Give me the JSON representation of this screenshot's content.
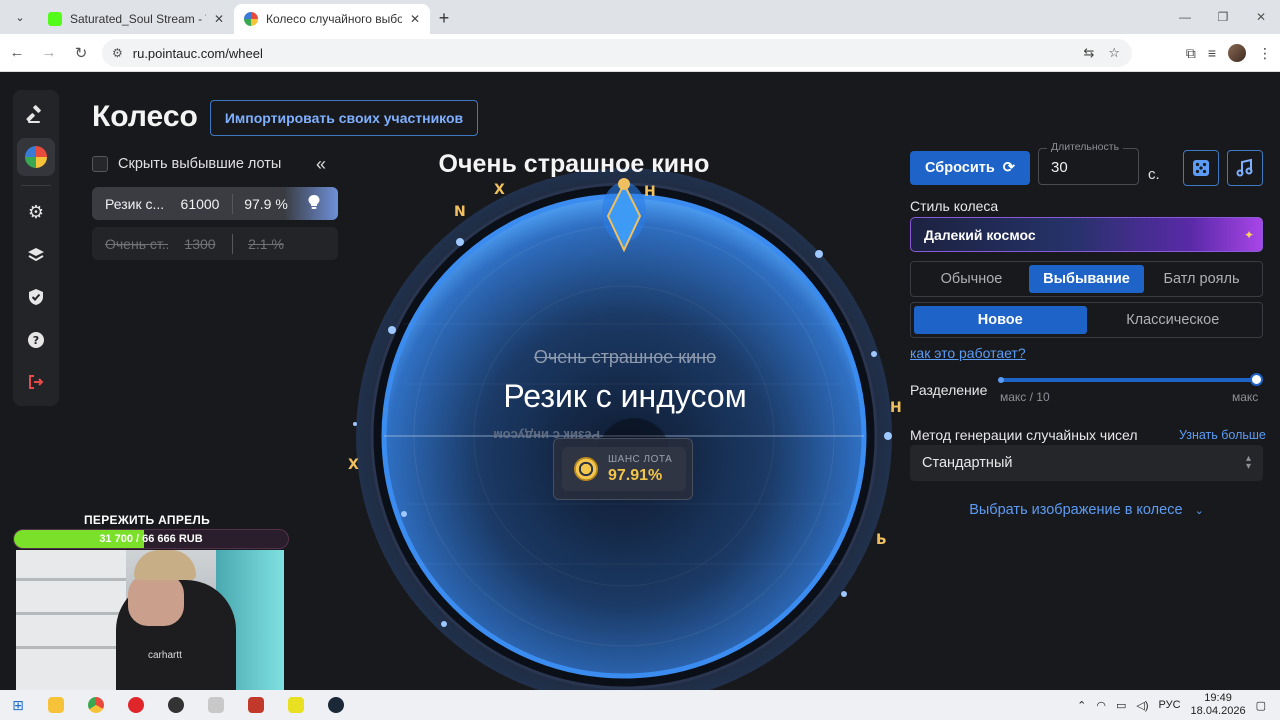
{
  "browser": {
    "tabs": [
      {
        "title": "Saturated_Soul Stream - Watch",
        "active": false
      },
      {
        "title": "Колесо случайного выбора – P",
        "active": true
      }
    ],
    "url": "ru.pointauc.com/wheel"
  },
  "page": {
    "title": "Колесо",
    "import_label": "Импортировать своих участников",
    "hide_label": "Скрыть выбывшие лоты",
    "collapse_icon": "«"
  },
  "lots": [
    {
      "name": "Резик с...",
      "amount": "61000",
      "percent": "97.9 %",
      "eliminated": false
    },
    {
      "name": "Очень ст...",
      "amount": "1300",
      "percent": "2.1 %",
      "eliminated": true
    }
  ],
  "wheel": {
    "winner_title": "Очень страшное кино",
    "eliminated_name": "Очень страшное кино",
    "current_name": "Резик с индусом",
    "mirrored_label": "Резик с индусом",
    "chance_label": "ШАНС ЛОТА",
    "chance_value": "97.91%"
  },
  "controls": {
    "reset_label": "Сбросить",
    "duration_legend": "Длительность",
    "duration_value": "30",
    "duration_unit": "с.",
    "style_label": "Стиль колеса",
    "style_value": "Далекий космос",
    "modes": [
      "Обычное",
      "Выбывание",
      "Батл рояль"
    ],
    "active_mode": 1,
    "submodes": [
      "Новое",
      "Классическое"
    ],
    "active_submode": 0,
    "how_link": "как это работает?",
    "split_label": "Разделение",
    "split_min": "макс / 10",
    "split_max": "макс",
    "split_value_fraction": 1.0,
    "rng_label": "Метод генерации случайных чисел",
    "rng_more": "Узнать больше",
    "rng_value": "Стандартный",
    "image_link": "Выбрать изображение в колесе"
  },
  "stream": {
    "goal_title": "ПЕРЕЖИТЬ АПРЕЛЬ",
    "goal_text": "31 700 / 66 666 RUB",
    "goal_fraction": 0.4755,
    "cam_text": "carhartt"
  },
  "taskbar": {
    "lang": "РУС",
    "time": "19:49",
    "date": "18.04.2026"
  },
  "colors": {
    "accent": "#1e64c8",
    "link": "#5d9cf5",
    "wheel_edge": "#3b8cf0",
    "goal_fill": "#7ae02a",
    "chance_gold": "#f4c449"
  }
}
